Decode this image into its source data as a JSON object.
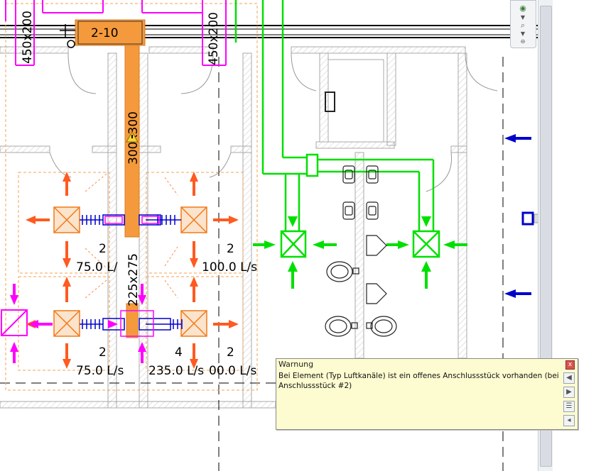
{
  "drawing": {
    "room_tag": "2-10",
    "duct_labels": {
      "top_left": "450x200",
      "top_right": "450x200",
      "main_vertical": "300x300",
      "lower_vertical": "225x275"
    },
    "air_terminals": {
      "upper_left": {
        "count": "2",
        "flow": "75.0 L/"
      },
      "upper_right": {
        "count": "2",
        "flow": "100.0 L/s"
      },
      "lower_left": {
        "count": "2",
        "flow": "75.0 L/s"
      },
      "lower_mid": {
        "count": "4",
        "flow": "235.0 L/s"
      },
      "lower_right": {
        "count": "2",
        "flow": "00.0 L/s"
      }
    },
    "colors": {
      "duct": "#f59a3c",
      "supply": "#ff00ff",
      "return": "#00e000",
      "arrow": "#ff5a1f",
      "wall": "#a8a8a8",
      "connector": "#0000cc"
    }
  },
  "navbar": {
    "icons": [
      "steering-wheel-icon",
      "zoom-icon"
    ]
  },
  "warning": {
    "title": "Warnung",
    "message": "Bei Element (Typ Luftkanäle) ist ein offenes Anschlussstück vorhanden (bei Anschlussstück #2)",
    "close_label": "x",
    "tools": [
      "previous-icon",
      "next-icon",
      "details-icon",
      "expand-icon"
    ]
  }
}
